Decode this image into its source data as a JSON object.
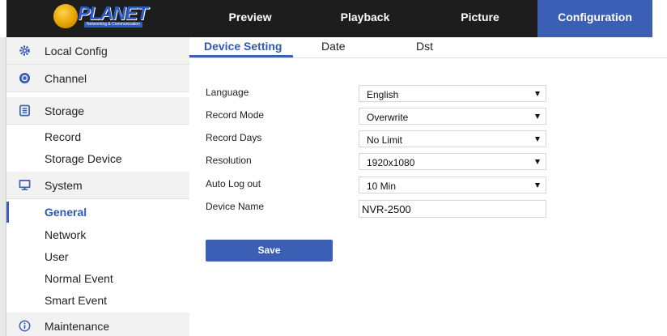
{
  "brand": {
    "logo_text": "PLANET",
    "logo_subtext": "Networking & Communication"
  },
  "nav": {
    "tabs": [
      {
        "label": "Preview",
        "active": false
      },
      {
        "label": "Playback",
        "active": false
      },
      {
        "label": "Picture",
        "active": false
      },
      {
        "label": "Configuration",
        "active": true
      }
    ]
  },
  "sidebar": {
    "sections": [
      {
        "label": "Local Config",
        "icon": "gear-icon"
      },
      {
        "label": "Channel",
        "icon": "camera-icon"
      },
      {
        "label": "Storage",
        "icon": "storage-icon",
        "items": [
          "Record",
          "Storage Device"
        ]
      },
      {
        "label": "System",
        "icon": "monitor-icon",
        "items": [
          "General",
          "Network",
          "User",
          "Normal Event",
          "Smart Event"
        ],
        "active_item": "General"
      },
      {
        "label": "Maintenance",
        "icon": "info-icon"
      }
    ]
  },
  "subtabs": [
    {
      "label": "Device Setting",
      "active": true
    },
    {
      "label": "Date",
      "active": false
    },
    {
      "label": "Dst",
      "active": false
    }
  ],
  "form": {
    "language": {
      "label": "Language",
      "value": "English"
    },
    "record_mode": {
      "label": "Record Mode",
      "value": "Overwrite"
    },
    "record_days": {
      "label": "Record Days",
      "value": "No Limit"
    },
    "resolution": {
      "label": "Resolution",
      "value": "1920x1080"
    },
    "auto_logout": {
      "label": "Auto Log out",
      "value": "10 Min"
    },
    "device_name": {
      "label": "Device Name",
      "value": "NVR-2500"
    },
    "save_label": "Save"
  },
  "colors": {
    "accent": "#3a5fb5",
    "topbar": "#1d1d1d",
    "sidebar_section_bg": "#f2f2f2"
  }
}
